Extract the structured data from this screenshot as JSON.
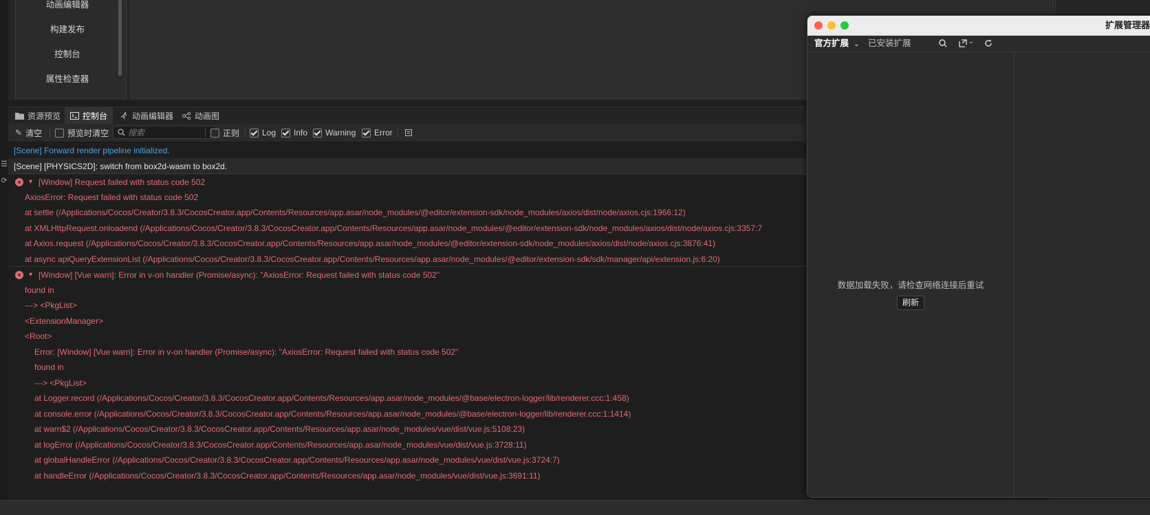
{
  "menu": {
    "items": [
      "动画编辑器",
      "构建发布",
      "控制台",
      "属性检查器"
    ]
  },
  "tabs": [
    {
      "label": "资源预览",
      "icon": "folder-icon"
    },
    {
      "label": "控制台",
      "icon": "terminal-icon"
    },
    {
      "label": "动画编辑器",
      "icon": "running-figure-icon"
    },
    {
      "label": "动画图",
      "icon": "animation-graph-icon"
    }
  ],
  "toolbar": {
    "clear_label": "清空",
    "preview_clear_label": "预览时清空",
    "search_placeholder": "搜索",
    "regex_label": "正则",
    "log_label": "Log",
    "info_label": "Info",
    "warning_label": "Warning",
    "error_label": "Error"
  },
  "console": {
    "lines": [
      {
        "type": "info",
        "text": "[Scene] Forward render pipeline initialized."
      },
      {
        "type": "log",
        "text": "[Scene] [PHYSICS2D]: switch from box2d-wasm to box2d."
      },
      {
        "type": "err-head",
        "text": "[Window] Request failed with status code 502"
      },
      {
        "type": "err",
        "indent": 1,
        "text": "AxiosError: Request failed with status code 502"
      },
      {
        "type": "err",
        "indent": 1,
        "text": "at settle (/Applications/Cocos/Creator/3.8.3/CocosCreator.app/Contents/Resources/app.asar/node_modules/@editor/extension-sdk/node_modules/axios/dist/node/axios.cjs:1966:12)"
      },
      {
        "type": "err",
        "indent": 1,
        "text": "at XMLHttpRequest.onloadend (/Applications/Cocos/Creator/3.8.3/CocosCreator.app/Contents/Resources/app.asar/node_modules/@editor/extension-sdk/node_modules/axios/dist/node/axios.cjs:3357:7"
      },
      {
        "type": "err",
        "indent": 1,
        "text": "at Axios.request (/Applications/Cocos/Creator/3.8.3/CocosCreator.app/Contents/Resources/app.asar/node_modules/@editor/extension-sdk/node_modules/axios/dist/node/axios.cjs:3876:41)"
      },
      {
        "type": "err",
        "indent": 1,
        "text": "at async apiQueryExtensionList (/Applications/Cocos/Creator/3.8.3/CocosCreator.app/Contents/Resources/app.asar/node_modules/@editor/extension-sdk/sdk/manager/api/extension.js:6:20)"
      },
      {
        "type": "err-head",
        "text": "[Window] [Vue warn]: Error in v-on handler (Promise/async): \"AxiosError: Request failed with status code 502\""
      },
      {
        "type": "err",
        "indent": 1,
        "text": "found in"
      },
      {
        "type": "err",
        "indent": 1,
        "text": "---> <PkgList>"
      },
      {
        "type": "err",
        "indent": 1,
        "text": "<ExtensionManager>"
      },
      {
        "type": "err",
        "indent": 1,
        "text": "<Root>"
      },
      {
        "type": "err",
        "indent": 2,
        "text": "Error: [Window] [Vue warn]: Error in v-on handler (Promise/async): \"AxiosError: Request failed with status code 502\""
      },
      {
        "type": "err",
        "indent": 2,
        "text": "found in"
      },
      {
        "type": "err",
        "indent": 2,
        "text": "---> <PkgList>"
      },
      {
        "type": "err",
        "indent": 2,
        "text": "at Logger.record (/Applications/Cocos/Creator/3.8.3/CocosCreator.app/Contents/Resources/app.asar/node_modules/@base/electron-logger/lib/renderer.ccc:1:458)"
      },
      {
        "type": "err",
        "indent": 2,
        "text": "at console.error (/Applications/Cocos/Creator/3.8.3/CocosCreator.app/Contents/Resources/app.asar/node_modules/@base/electron-logger/lib/renderer.ccc:1:1414)"
      },
      {
        "type": "err",
        "indent": 2,
        "text": "at warn$2 (/Applications/Cocos/Creator/3.8.3/CocosCreator.app/Contents/Resources/app.asar/node_modules/vue/dist/vue.js:5108:23)"
      },
      {
        "type": "err",
        "indent": 2,
        "text": "at logError (/Applications/Cocos/Creator/3.8.3/CocosCreator.app/Contents/Resources/app.asar/node_modules/vue/dist/vue.js:3728:11)"
      },
      {
        "type": "err",
        "indent": 2,
        "text": "at globalHandleError (/Applications/Cocos/Creator/3.8.3/CocosCreator.app/Contents/Resources/app.asar/node_modules/vue/dist/vue.js:3724:7)"
      },
      {
        "type": "err",
        "indent": 2,
        "text": "at handleError (/Applications/Cocos/Creator/3.8.3/CocosCreator.app/Contents/Resources/app.asar/node_modules/vue/dist/vue.js:3691:11)"
      }
    ]
  },
  "ext_window": {
    "title": "扩展管理器",
    "tab_official": "官方扩展",
    "tab_installed": "已安装扩展",
    "message": "数据加载失败，请检查网络连接后重试",
    "refresh_label": "刷新"
  },
  "colors": {
    "error": "#e06c75",
    "info": "#4aa3e0",
    "close_light": "#ff5f57",
    "minimize_light": "#febc2e",
    "zoom_light": "#28c840"
  }
}
